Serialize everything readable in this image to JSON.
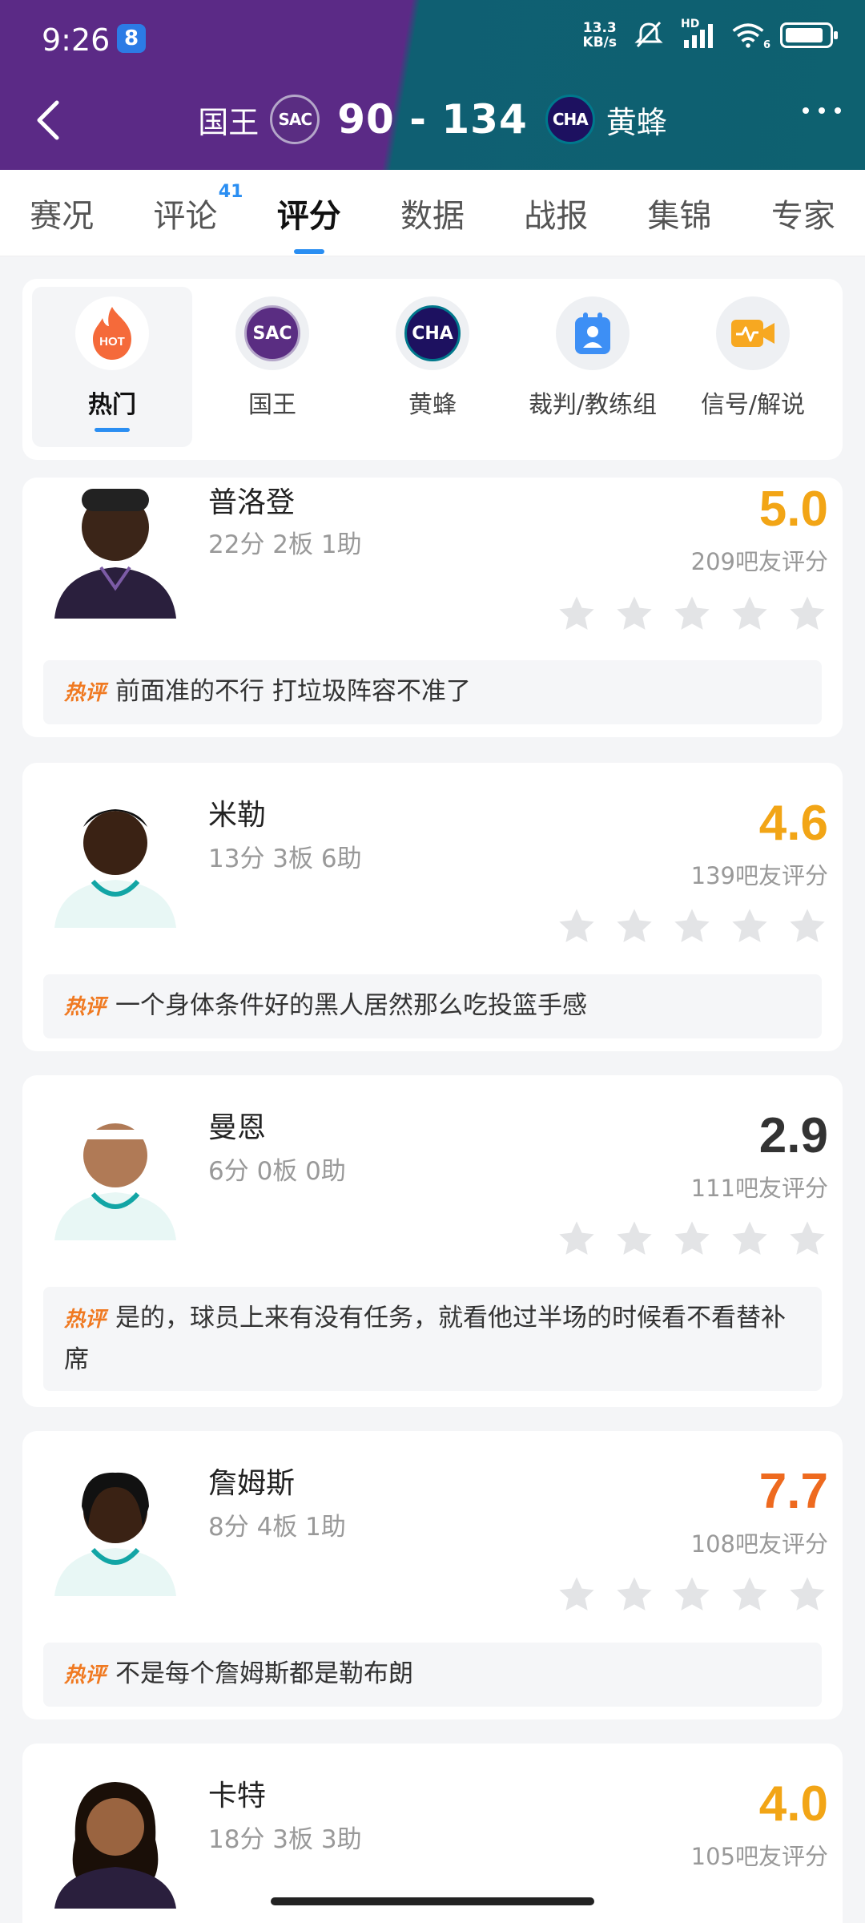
{
  "status_bar": {
    "time": "9:26",
    "badge": "8",
    "net_speed_top": "13.3",
    "net_speed_bottom": "KB/s",
    "hd_label": "HD",
    "wifi_label": "6"
  },
  "header": {
    "home_team": "国王",
    "home_logo": "SAC",
    "score": "90 - 134",
    "away_logo": "CHA",
    "away_team": "黄蜂"
  },
  "tabs": [
    {
      "label": "赛况"
    },
    {
      "label": "评论",
      "sup": "41"
    },
    {
      "label": "评分"
    },
    {
      "label": "数据"
    },
    {
      "label": "战报"
    },
    {
      "label": "集锦"
    },
    {
      "label": "专家"
    }
  ],
  "categories": [
    {
      "label": "热门",
      "icon": "fire-hot-icon",
      "icon_text": "HOT"
    },
    {
      "label": "国王",
      "icon": "sac-logo-icon",
      "icon_text": "SAC"
    },
    {
      "label": "黄蜂",
      "icon": "cha-logo-icon",
      "icon_text": "CHA"
    },
    {
      "label": "裁判/教练组",
      "icon": "referee-icon"
    },
    {
      "label": "信号/解说",
      "icon": "video-signal-icon"
    }
  ],
  "players": [
    {
      "name": "普洛登",
      "stats": "22分 2板 1助",
      "score": "5.0",
      "score_color": "#f2a516",
      "votes": "209吧友评分",
      "hot_label": "热评",
      "comment": "前面准的不行 打垃圾阵容不准了",
      "jersey": "#2a1f3d"
    },
    {
      "name": "米勒",
      "stats": "13分 3板 6助",
      "score": "4.6",
      "score_color": "#f2a516",
      "votes": "139吧友评分",
      "hot_label": "热评",
      "comment": "一个身体条件好的黑人居然那么吃投篮手感",
      "jersey": "#e8f7f5"
    },
    {
      "name": "曼恩",
      "stats": "6分 0板 0助",
      "score": "2.9",
      "score_color": "#333333",
      "votes": "111吧友评分",
      "hot_label": "热评",
      "comment": "是的，球员上来有没有任务，就看他过半场的时候看不看替补席",
      "jersey": "#e8f7f5"
    },
    {
      "name": "詹姆斯",
      "stats": "8分 4板 1助",
      "score": "7.7",
      "score_color": "#ee6a1f",
      "votes": "108吧友评分",
      "hot_label": "热评",
      "comment": "不是每个詹姆斯都是勒布朗",
      "jersey": "#e8f7f5"
    },
    {
      "name": "卡特",
      "stats": "18分 3板 3助",
      "score": "4.0",
      "score_color": "#f2a516",
      "votes": "105吧友评分",
      "jersey": "#2a1f3d"
    }
  ]
}
